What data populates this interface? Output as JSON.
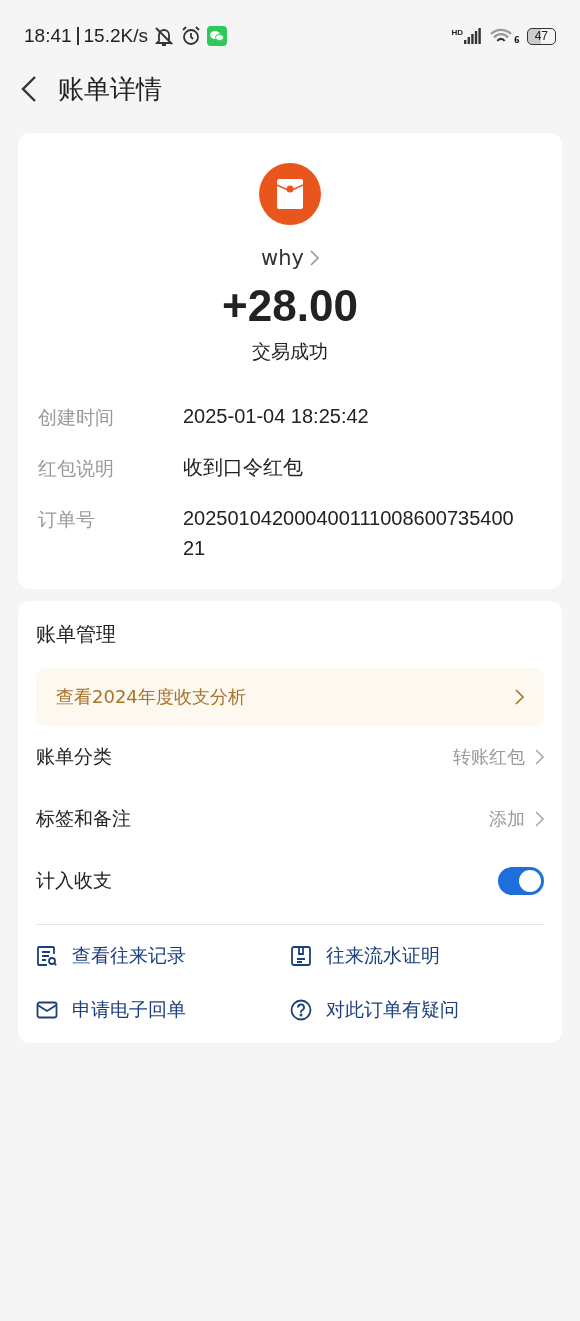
{
  "status_bar": {
    "time": "18:41",
    "speed": "15.2K/s",
    "network": "HD",
    "wifi_band": "6",
    "battery": "47"
  },
  "header": {
    "title": "账单详情"
  },
  "summary": {
    "payer": "why",
    "amount": "+28.00",
    "status": "交易成功"
  },
  "details": [
    {
      "label": "创建时间",
      "value": "2025-01-04 18:25:42"
    },
    {
      "label": "红包说明",
      "value": "收到口令红包"
    },
    {
      "label": "订单号",
      "value": "20250104200040011100860073540021"
    }
  ],
  "management": {
    "title": "账单管理",
    "banner": "查看2024年度收支分析",
    "rows": [
      {
        "kind": "link",
        "label": "账单分类",
        "value": "转账红包"
      },
      {
        "kind": "link",
        "label": "标签和备注",
        "value": "添加"
      },
      {
        "kind": "toggle",
        "label": "计入收支",
        "on": true
      }
    ],
    "actions": [
      {
        "kind": "records",
        "label": "查看往来记录"
      },
      {
        "kind": "statement",
        "label": "往来流水证明"
      },
      {
        "kind": "receipt",
        "label": "申请电子回单"
      },
      {
        "kind": "question",
        "label": "对此订单有疑问"
      }
    ]
  }
}
